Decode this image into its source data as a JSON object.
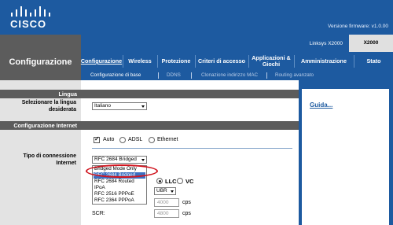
{
  "header": {
    "logo_text": "CISCO",
    "firmware": "Versione firmware: v1.0.00"
  },
  "model": {
    "name": "Linksys X2000",
    "badge": "X2000"
  },
  "page_title": "Configurazione",
  "main_nav": [
    {
      "label": "Configurazione",
      "active": true
    },
    {
      "label": "Wireless",
      "active": false
    },
    {
      "label": "Protezione",
      "active": false
    },
    {
      "label": "Criteri di accesso",
      "active": false
    },
    {
      "label": "Applicazioni & Giochi",
      "active": false
    },
    {
      "label": "Amministrazione",
      "active": false
    },
    {
      "label": "Stato",
      "active": false
    }
  ],
  "sub_nav": [
    {
      "label": "Configurazione di base",
      "active": true
    },
    {
      "label": "DDNS",
      "active": false
    },
    {
      "label": "Clonazione indirizzo MAC",
      "active": false
    },
    {
      "label": "Routing avanzato",
      "active": false
    }
  ],
  "sections": {
    "language": {
      "title": "Lingua",
      "label": "Selezionare la lingua desiderata",
      "value": "Italiano"
    },
    "internet": {
      "title": "Configurazione Internet",
      "mode_options": [
        {
          "label": "Auto",
          "checked": true
        },
        {
          "label": "ADSL",
          "checked": false
        },
        {
          "label": "Ethernet",
          "checked": false
        }
      ],
      "connection_label": "Tipo di connessione Internet",
      "connection_value": "RFC 2684 Bridged",
      "dropdown_options": [
        {
          "label": "Bridged Mode Only",
          "highlighted": false
        },
        {
          "label": "RFC 2684 Bridged",
          "highlighted": true
        },
        {
          "label": "RFC 2684 Routed",
          "highlighted": false
        },
        {
          "label": "IPoA",
          "highlighted": false
        },
        {
          "label": "RFC 2516 PPPoE",
          "highlighted": false
        },
        {
          "label": "RFC 2364 PPPoA",
          "highlighted": false
        }
      ],
      "encap_options": [
        {
          "label": "LLC",
          "checked": true
        },
        {
          "label": "VC",
          "checked": false
        }
      ],
      "qos_value": "UBR",
      "pcr_value": "4000",
      "scr_label": "SCR:",
      "scr_value": "4800",
      "unit": "cps"
    }
  },
  "help": {
    "link": "Guida..."
  },
  "colors": {
    "brand_blue": "#1d5aa0",
    "dark_gray": "#5c5c5c",
    "highlight_ring": "#d0141e"
  }
}
